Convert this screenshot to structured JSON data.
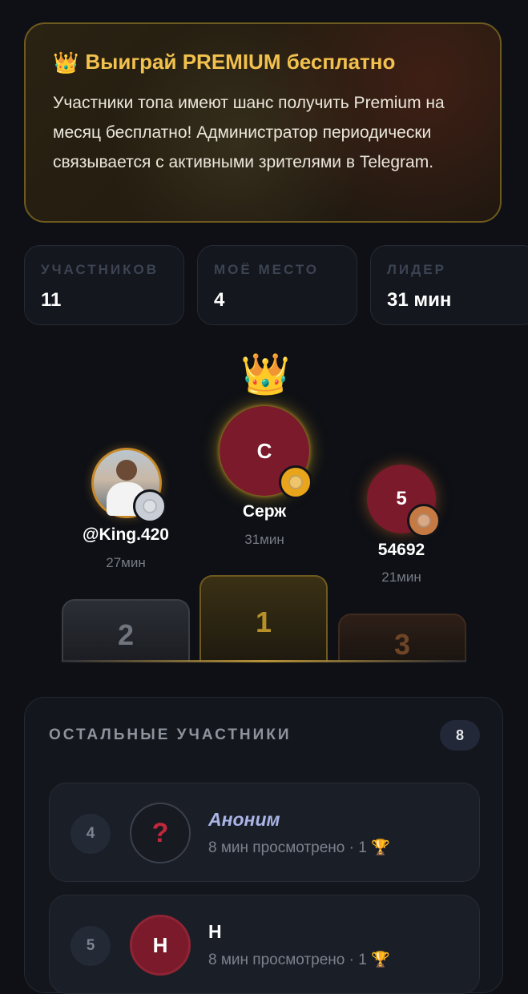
{
  "promo": {
    "icon": "crown-icon",
    "title": "Выиграй PREMIUM бесплатно",
    "text": "Участники топа имеют шанс получить Premium на месяц бесплатно! Администратор периодически связывается с активными зрителями в Telegram."
  },
  "stats": [
    {
      "label": "УЧАСТНИКОВ",
      "value": "11"
    },
    {
      "label": "МОЁ МЕСТО",
      "value": "4"
    },
    {
      "label": "ЛИДЕР",
      "value": "31 мин"
    }
  ],
  "podium": {
    "first": {
      "initial": "С",
      "name": "Серж",
      "time": "31мин",
      "place": "1",
      "medal": "gold-medal-icon"
    },
    "second": {
      "name": "@King.420",
      "time": "27мин",
      "place": "2",
      "medal": "silver-medal-icon"
    },
    "third": {
      "initial": "5",
      "name": "54692",
      "time": "21мин",
      "place": "3",
      "medal": "bronze-medal-icon"
    }
  },
  "others": {
    "title": "ОСТАЛЬНЫЕ УЧАСТНИКИ",
    "count": "8",
    "rows": [
      {
        "rank": "4",
        "avatar": "?",
        "name": "Аноним",
        "meta": "8 мин просмотрено · 1",
        "meta_icon": "trophy-icon"
      },
      {
        "rank": "5",
        "avatar": "Н",
        "name": "Н",
        "meta": "8 мин просмотрено · 1",
        "meta_icon": "trophy-icon"
      }
    ]
  },
  "colors": {
    "background": "#0e1015",
    "gold": "#f2c14e",
    "avatar_red": "#7a1a2b",
    "anon_name": "#aab4e6"
  }
}
